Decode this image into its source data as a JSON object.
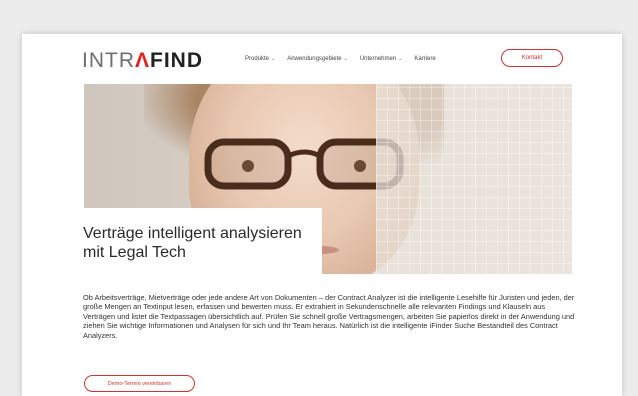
{
  "header": {
    "logo": {
      "part1": "INTR",
      "part2": "Λ",
      "part3": "FIND"
    },
    "nav": [
      {
        "label": "Produkte",
        "has_dropdown": true
      },
      {
        "label": "Anwendungsgebiete",
        "has_dropdown": true
      },
      {
        "label": "Unternehmen",
        "has_dropdown": true
      },
      {
        "label": "Karriere",
        "has_dropdown": false
      }
    ],
    "contact_label": "Kontakt"
  },
  "hero": {
    "headline": "Verträge intelligent analysieren mit Legal Tech"
  },
  "main": {
    "body": "Ob Arbeitsverträge, Mietverträge oder jede andere Art von Dokumenten – der Contract Analyzer ist die intelligente Lesehilfe für Juristen und jeden, der große Mengen an Textinput lesen, erfassen und bewerten muss. Er extrahiert in Sekundenschnelle alle relevanten Findings und Klauseln aus Verträgen und listet die Textpassagen übersichtlich auf. Prüfen Sie schnell große Vertragsmengen, arbeiten Sie papierlos direkt in der Anwendung und ziehen Sie wichtige Informationen und Analysen für sich und Ihr Team heraus. Natürlich ist die intelligente iFinder Suche Bestandteil des Contract Analyzers.",
    "demo_label": "Demo-Termin vereinbaren"
  },
  "colors": {
    "accent": "#d6312b",
    "logo_gray": "#6e6e6e",
    "page_bg": "#ececec"
  },
  "icons": {
    "dropdown": "chevron-down-icon"
  }
}
